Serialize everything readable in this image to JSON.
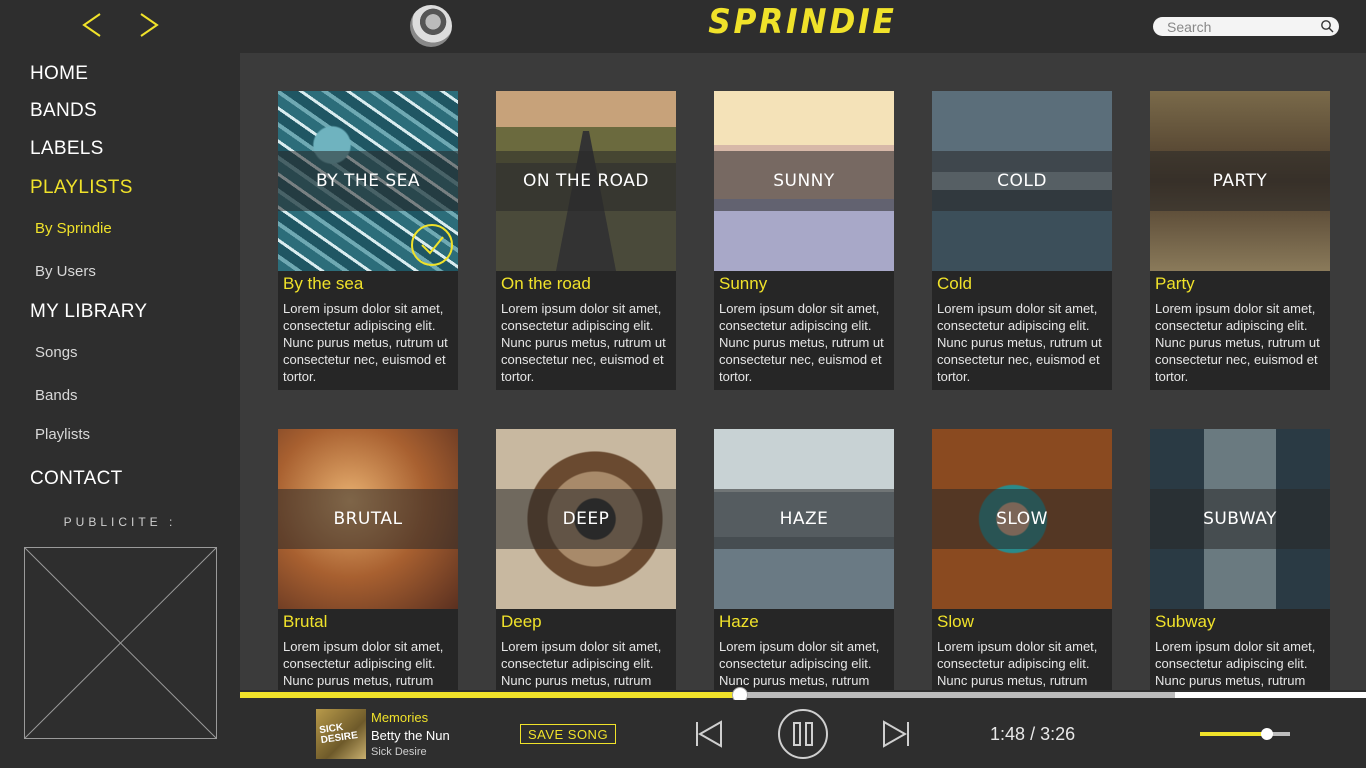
{
  "app": {
    "logo": "SPRINDIE"
  },
  "header": {
    "search_placeholder": "Search"
  },
  "sidebar": {
    "home": "HOME",
    "bands": "BANDS",
    "labels": "LABELS",
    "playlists": "PLAYLISTS",
    "by_sprindie": "By Sprindie",
    "by_users": "By Users",
    "my_library": "MY LIBRARY",
    "songs": "Songs",
    "lib_bands": "Bands",
    "lib_playlists": "Playlists",
    "contact": "CONTACT",
    "publicite": "PUBLICITE :"
  },
  "playlists": [
    {
      "overlay": "BY THE SEA",
      "title": "By the sea",
      "desc": "Lorem ipsum dolor sit amet, consectetur adipiscing elit. Nunc purus metus, rutrum ut consectetur nec, euismod et tortor.",
      "selected": true
    },
    {
      "overlay": "ON THE ROAD",
      "title": "On the road",
      "desc": "Lorem ipsum dolor sit amet, consectetur adipiscing elit. Nunc purus metus, rutrum ut consectetur nec, euismod et tortor."
    },
    {
      "overlay": "SUNNY",
      "title": "Sunny",
      "desc": "Lorem ipsum dolor sit amet, consectetur adipiscing elit. Nunc purus metus, rutrum ut consectetur nec, euismod et tortor."
    },
    {
      "overlay": "COLD",
      "title": "Cold",
      "desc": "Lorem ipsum dolor sit amet, consectetur adipiscing elit. Nunc purus metus, rutrum ut consectetur nec, euismod et tortor."
    },
    {
      "overlay": "PARTY",
      "title": "Party",
      "desc": "Lorem ipsum dolor sit amet, consectetur adipiscing elit. Nunc purus metus, rutrum ut consectetur nec, euismod et tortor."
    },
    {
      "overlay": "BRUTAL",
      "title": "Brutal",
      "desc": "Lorem ipsum dolor sit amet, consectetur adipiscing elit. Nunc purus metus, rutrum"
    },
    {
      "overlay": "DEEP",
      "title": "Deep",
      "desc": "Lorem ipsum dolor sit amet, consectetur adipiscing elit. Nunc purus metus, rutrum"
    },
    {
      "overlay": "HAZE",
      "title": "Haze",
      "desc": "Lorem ipsum dolor sit amet, consectetur adipiscing elit. Nunc purus metus, rutrum"
    },
    {
      "overlay": "SLOW",
      "title": "Slow",
      "desc": "Lorem ipsum dolor sit amet, consectetur adipiscing elit. Nunc purus metus, rutrum"
    },
    {
      "overlay": "SUBWAY",
      "title": "Subway",
      "desc": "Lorem ipsum dolor sit amet, consectetur adipiscing elit. Nunc purus metus, rutrum"
    }
  ],
  "player": {
    "song_title": "Memories",
    "artist": "Betty the Nun",
    "album": "Sick Desire",
    "cover_text": "SICK DESIRE",
    "save_label": "SAVE SONG",
    "current_time": "1:48",
    "separator": "/",
    "total_time": "3:26",
    "progress_fraction": 0.444,
    "volume_fraction": 0.74
  },
  "colors": {
    "accent": "#f0e22a",
    "background": "#2e2e2e",
    "panel": "#3b3b3b"
  },
  "icons": {
    "back": "chevron-left-icon",
    "forward": "chevron-right-icon",
    "search": "search-icon",
    "check": "check-circle-icon",
    "prev": "skip-back-icon",
    "pause": "pause-icon",
    "next": "skip-forward-icon"
  }
}
